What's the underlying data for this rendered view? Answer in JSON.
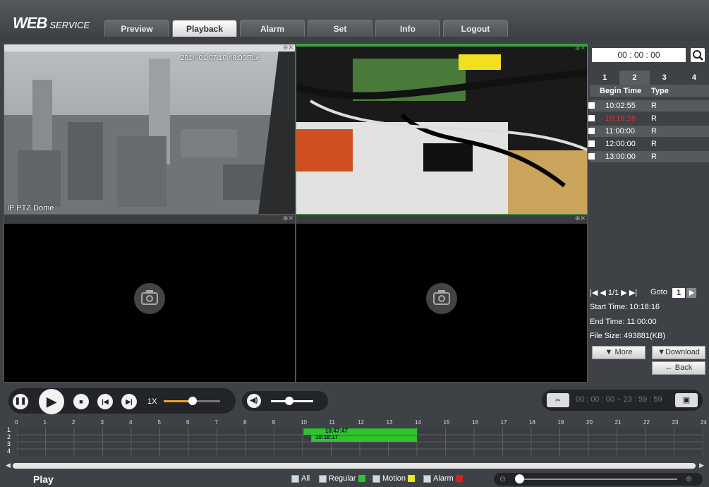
{
  "brand": {
    "main": "WEB",
    "sub": "SERVICE"
  },
  "tabs": [
    "Preview",
    "Playback",
    "Alarm",
    "Set",
    "Info",
    "Logout"
  ],
  "cells": {
    "c1_overlay": "2014-01-07 10:48:06 Tue",
    "c1_name": "IP PTZ Dome"
  },
  "search": {
    "time": "00 : 00 : 00"
  },
  "channels": [
    "1",
    "2",
    "3",
    "4"
  ],
  "list": {
    "head_time": "Begin Time",
    "head_type": "Type",
    "rows": [
      {
        "time": "10:02:55",
        "type": "R"
      },
      {
        "time": "10:18:16",
        "type": "R"
      },
      {
        "time": "11:00:00",
        "type": "R"
      },
      {
        "time": "12:00:00",
        "type": "R"
      },
      {
        "time": "13:00:00",
        "type": "R"
      }
    ]
  },
  "pager": {
    "pages": "1/1",
    "goto_label": "Goto",
    "goto_value": "1"
  },
  "fileinfo": {
    "start": "Start Time: 10:18:16",
    "end": "End Time: 11:00:00",
    "size": "File Size: 493881(KB)"
  },
  "buttons": {
    "more": "More",
    "download": "Download",
    "back": "Back"
  },
  "playback": {
    "speed": "1X",
    "clip_start": "00 : 00 : 00",
    "clip_end": "23 : 59 : 59"
  },
  "timeline": {
    "hours": [
      "0",
      "1",
      "2",
      "3",
      "4",
      "5",
      "6",
      "7",
      "8",
      "9",
      "10",
      "11",
      "12",
      "13",
      "14",
      "15",
      "16",
      "17",
      "18",
      "19",
      "20",
      "21",
      "22",
      "23",
      "24"
    ],
    "rows": [
      "1",
      "2",
      "3",
      "4"
    ],
    "marker1": "10:47:47",
    "marker2": "10:18:17"
  },
  "bottom": {
    "status": "Play",
    "all": "All",
    "regular": "Regular",
    "motion": "Motion",
    "alarm": "Alarm"
  },
  "colors": {
    "regular": "#2ec42e",
    "motion": "#e8e81e",
    "alarm": "#d22020",
    "selected_border": "#3c9f3c"
  }
}
